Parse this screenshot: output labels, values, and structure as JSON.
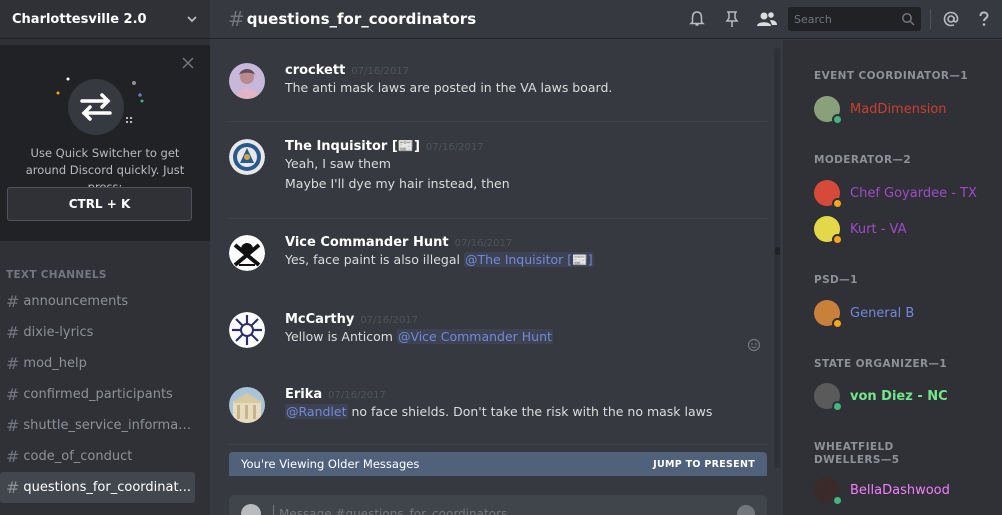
{
  "guild": {
    "name": "Charlottesville 2.0"
  },
  "quick_switcher": {
    "text": "Use Quick Switcher to get around Discord quickly. Just press:",
    "shortcut": "CTRL + K"
  },
  "channels": {
    "category": "TEXT CHANNELS",
    "items": [
      {
        "label": "announcements"
      },
      {
        "label": "dixie-lyrics"
      },
      {
        "label": "mod_help"
      },
      {
        "label": "confirmed_participants"
      },
      {
        "label": "shuttle_service_informat..."
      },
      {
        "label": "code_of_conduct"
      },
      {
        "label": "questions_for_coordinat...",
        "active": true
      }
    ]
  },
  "header": {
    "channel": "questions_for_coordinators",
    "search_placeholder": "Search"
  },
  "messages": [
    {
      "author": "crockett",
      "timestamp": "07/16/2017",
      "lines": [
        "The anti mask laws are posted in the VA laws board."
      ]
    },
    {
      "author": "The Inquisitor [📰]",
      "timestamp": "07/16/2017",
      "lines": [
        "Yeah, I saw them",
        "Maybe I'll dye my hair instead, then"
      ]
    },
    {
      "author": "Vice Commander Hunt",
      "timestamp": "07/16/2017",
      "text": "Yes, face paint is also illegal ",
      "mention": "@The Inquisitor [📰]"
    },
    {
      "author": "McCarthy",
      "timestamp": "07/16/2017",
      "text": "Yellow is Anticom ",
      "mention": "@Vice Commander Hunt"
    },
    {
      "author": "Erika",
      "timestamp": "07/16/2017",
      "mention": "@Randlet",
      "text": " no face shields. Don't take the risk with the no mask laws"
    }
  ],
  "older_bar": {
    "text": "You're Viewing Older Messages",
    "jump": "JUMP TO PRESENT"
  },
  "composer": {
    "placeholder": "Message #questions_for_coordinators"
  },
  "members": {
    "groups": [
      {
        "role": "EVENT COORDINATOR—1",
        "members": [
          {
            "name": "MadDimension",
            "color": "#c94030",
            "status": "#43b581"
          }
        ]
      },
      {
        "role": "MODERATOR—2",
        "members": [
          {
            "name": "Chef Goyardee - TX",
            "color": "#a04bc8",
            "status": "#faa61a"
          },
          {
            "name": "Kurt - VA",
            "color": "#a04bc8",
            "status": "#faa61a"
          }
        ]
      },
      {
        "role": "PSD—1",
        "members": [
          {
            "name": "General B",
            "color": "#7289da",
            "status": "#faa61a"
          }
        ]
      },
      {
        "role": "STATE ORGANIZER—1",
        "members": [
          {
            "name": "von Diez - NC",
            "color": "#71e88a",
            "status": "#43b581"
          }
        ]
      },
      {
        "role": "WHEATFIELD DWELLERS—5",
        "members": [
          {
            "name": "BellaDashwood",
            "color": "#f47fff",
            "status": "#43b581"
          }
        ]
      }
    ]
  }
}
